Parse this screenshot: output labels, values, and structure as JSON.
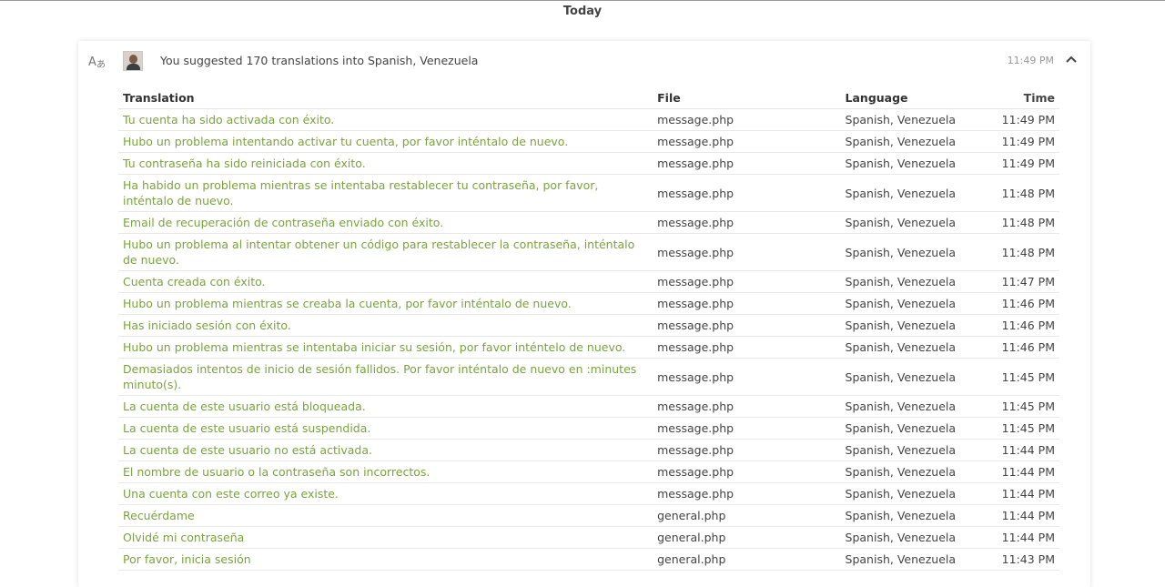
{
  "day_heading": "Today",
  "activity": {
    "summary": "You suggested 170 translations into Spanish, Venezuela",
    "time": "11:49 PM",
    "icons": {
      "activity": "translate-icon",
      "collapse": "chevron-up-icon",
      "avatar": "user-avatar"
    },
    "columns": {
      "translation": "Translation",
      "file": "File",
      "language": "Language",
      "time": "Time"
    },
    "rows": [
      {
        "translation": "Tu cuenta ha sido activada con éxito.",
        "file": "message.php",
        "language": "Spanish, Venezuela",
        "time": "11:49 PM"
      },
      {
        "translation": "Hubo un problema intentando activar tu cuenta, por favor inténtalo de nuevo.",
        "file": "message.php",
        "language": "Spanish, Venezuela",
        "time": "11:49 PM"
      },
      {
        "translation": "Tu contraseña ha sido reiniciada con éxito.",
        "file": "message.php",
        "language": "Spanish, Venezuela",
        "time": "11:49 PM"
      },
      {
        "translation": "Ha habido un problema mientras se intentaba restablecer tu contraseña, por favor, inténtalo de nuevo.",
        "file": "message.php",
        "language": "Spanish, Venezuela",
        "time": "11:48 PM"
      },
      {
        "translation": "Email de recuperación de contraseña enviado con éxito.",
        "file": "message.php",
        "language": "Spanish, Venezuela",
        "time": "11:48 PM"
      },
      {
        "translation": "Hubo un problema al intentar obtener un código para restablecer la contraseña, inténtalo de nuevo.",
        "file": "message.php",
        "language": "Spanish, Venezuela",
        "time": "11:48 PM"
      },
      {
        "translation": "Cuenta creada con éxito.",
        "file": "message.php",
        "language": "Spanish, Venezuela",
        "time": "11:47 PM"
      },
      {
        "translation": "Hubo un problema mientras se creaba la cuenta, por favor inténtalo de nuevo.",
        "file": "message.php",
        "language": "Spanish, Venezuela",
        "time": "11:46 PM"
      },
      {
        "translation": "Has iniciado sesión con éxito.",
        "file": "message.php",
        "language": "Spanish, Venezuela",
        "time": "11:46 PM"
      },
      {
        "translation": "Hubo un problema mientras se intentaba iniciar su sesión, por favor inténtelo de nuevo.",
        "file": "message.php",
        "language": "Spanish, Venezuela",
        "time": "11:46 PM"
      },
      {
        "translation": "Demasiados intentos de inicio de sesión fallidos. Por favor inténtalo de nuevo en :minutes minuto(s).",
        "file": "message.php",
        "language": "Spanish, Venezuela",
        "time": "11:45 PM"
      },
      {
        "translation": "La cuenta de este usuario está bloqueada.",
        "file": "message.php",
        "language": "Spanish, Venezuela",
        "time": "11:45 PM"
      },
      {
        "translation": "La cuenta de este usuario está suspendida.",
        "file": "message.php",
        "language": "Spanish, Venezuela",
        "time": "11:45 PM"
      },
      {
        "translation": "La cuenta de este usuario no está activada.",
        "file": "message.php",
        "language": "Spanish, Venezuela",
        "time": "11:44 PM"
      },
      {
        "translation": "El nombre de usuario o la contraseña son incorrectos.",
        "file": "message.php",
        "language": "Spanish, Venezuela",
        "time": "11:44 PM"
      },
      {
        "translation": "Una cuenta con este correo ya existe.",
        "file": "message.php",
        "language": "Spanish, Venezuela",
        "time": "11:44 PM"
      },
      {
        "translation": "Recuérdame",
        "file": "general.php",
        "language": "Spanish, Venezuela",
        "time": "11:44 PM"
      },
      {
        "translation": "Olvidé mi contraseña",
        "file": "general.php",
        "language": "Spanish, Venezuela",
        "time": "11:44 PM"
      },
      {
        "translation": "Por favor, inicia sesión",
        "file": "general.php",
        "language": "Spanish, Venezuela",
        "time": "11:43 PM"
      }
    ]
  }
}
